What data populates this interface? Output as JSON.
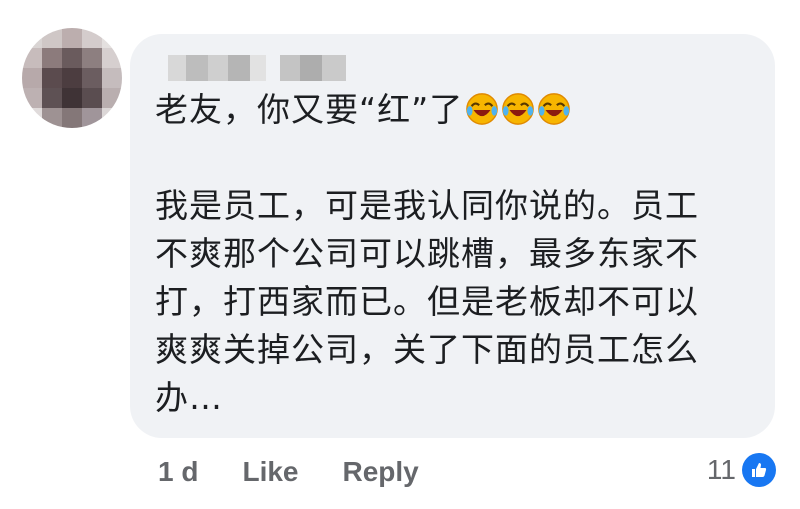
{
  "comment": {
    "lines": [
      "老友，你又要“红”了",
      "",
      "我是员工，可是我认同你说的。员工",
      "不爽那个公司可以跳槽，最多东家不",
      "打，打西家而已。但是老板却不可以",
      "爽爽关掉公司，关了下面的员工怎么",
      "办…"
    ],
    "emojis": [
      "face-with-tears-of-joy-icon",
      "face-with-tears-of-joy-icon",
      "face-with-tears-of-joy-icon"
    ]
  },
  "actions": {
    "time": "1 d",
    "like": "Like",
    "reply": "Reply"
  },
  "reactions": {
    "count": "11",
    "type": "like-icon"
  },
  "colors": {
    "bubble": "#f0f2f5",
    "text": "#1c1e21",
    "meta": "#65676b",
    "like_blue": "#1877f2"
  }
}
